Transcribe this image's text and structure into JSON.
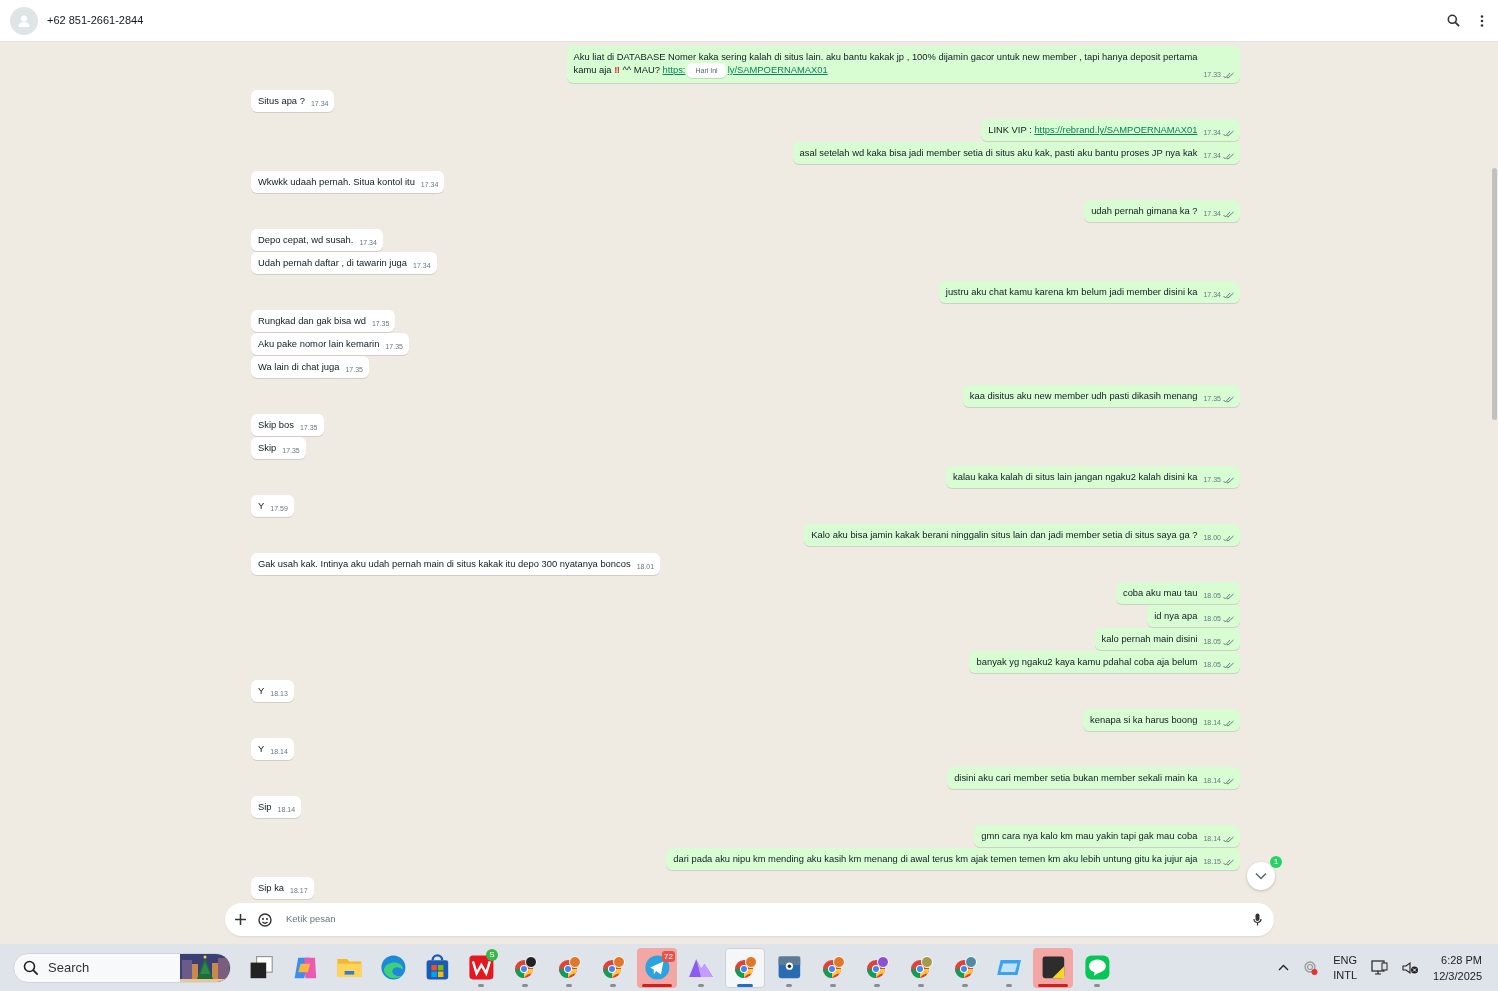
{
  "header": {
    "contact": "+62 851-2661-2844"
  },
  "date_chip": "Hari Ini",
  "messages": [
    {
      "outgoing": true,
      "time": "17.33",
      "segments": [
        {
          "kind": "text",
          "text": "Aku liat di DATABASE Nomer kaka sering kalah di situs lain. aku bantu kakak jp , 100% dijamin gacor untuk new member , tapi hanya deposit pertama"
        },
        {
          "kind": "break"
        },
        {
          "kind": "text",
          "text": "kamu aja "
        },
        {
          "kind": "alert",
          "text": "‼"
        },
        {
          "kind": "text",
          "text": " ^^ MAU? "
        },
        {
          "kind": "link",
          "text": "https:"
        },
        {
          "kind": "chip"
        },
        {
          "kind": "link",
          "text": "ly/SAMPOERNAMAX01"
        }
      ]
    },
    {
      "outgoing": false,
      "time": "17.34",
      "text": "Situs apa ?"
    },
    {
      "outgoing": true,
      "time": "17.34",
      "segments": [
        {
          "kind": "text",
          "text": "LINK VIP : "
        },
        {
          "kind": "link",
          "text": "https://rebrand.ly/SAMPOERNAMAX01"
        }
      ]
    },
    {
      "outgoing": true,
      "time": "17.34",
      "text": "asal setelah wd kaka bisa jadi member setia di situs aku kak, pasti aku bantu proses JP nya kak"
    },
    {
      "outgoing": false,
      "time": "17.34",
      "text": "Wkwkk udaah pernah. Situa kontol itu"
    },
    {
      "outgoing": true,
      "time": "17.34",
      "text": "udah pernah gimana ka ?"
    },
    {
      "outgoing": false,
      "time": "17.34",
      "text": "Depo cepat, wd susah."
    },
    {
      "outgoing": false,
      "time": "17.34",
      "text": "Udah pernah daftar , di tawarin juga"
    },
    {
      "outgoing": true,
      "time": "17.34",
      "text": "justru aku chat kamu karena km belum jadi member disini ka"
    },
    {
      "outgoing": false,
      "time": "17.35",
      "text": "Rungkad dan gak bisa wd"
    },
    {
      "outgoing": false,
      "time": "17.35",
      "text": "Aku pake nomor lain kemarin"
    },
    {
      "outgoing": false,
      "time": "17.35",
      "text": "Wa lain di chat juga"
    },
    {
      "outgoing": true,
      "time": "17.35",
      "text": "kaa disitus aku new member udh pasti dikasih menang"
    },
    {
      "outgoing": false,
      "time": "17.35",
      "text": "Skip bos"
    },
    {
      "outgoing": false,
      "time": "17.35",
      "text": "Skip"
    },
    {
      "outgoing": true,
      "time": "17.35",
      "text": "kalau kaka kalah di situs lain jangan ngaku2 kalah disini ka"
    },
    {
      "outgoing": false,
      "time": "17.59",
      "text": "Y"
    },
    {
      "outgoing": true,
      "time": "18.00",
      "text": "Kalo aku  bisa jamin kakak berani ninggalin situs lain dan jadi member setia di situs saya ga ?"
    },
    {
      "outgoing": false,
      "time": "18.01",
      "text": "Gak usah kak. Intinya aku udah pernah main di situs kakak itu depo 300 nyatanya boncos"
    },
    {
      "outgoing": true,
      "time": "18.05",
      "text": "coba aku mau tau"
    },
    {
      "outgoing": true,
      "time": "18.05",
      "text": "id nya apa"
    },
    {
      "outgoing": true,
      "time": "18.05",
      "text": "kalo pernah main disini"
    },
    {
      "outgoing": true,
      "time": "18.05",
      "text": "banyak yg ngaku2 kaya kamu pdahal coba aja belum"
    },
    {
      "outgoing": false,
      "time": "18.13",
      "text": "Y"
    },
    {
      "outgoing": true,
      "time": "18.14",
      "text": "kenapa si ka harus boong"
    },
    {
      "outgoing": false,
      "time": "18.14",
      "text": "Y"
    },
    {
      "outgoing": true,
      "time": "18.14",
      "text": "disini aku cari member setia bukan member sekali main ka"
    },
    {
      "outgoing": false,
      "time": "18.14",
      "text": "Sip"
    },
    {
      "outgoing": true,
      "time": "18.14",
      "text": "gmn cara nya kalo km mau yakin tapi gak mau coba"
    },
    {
      "outgoing": true,
      "time": "18.15",
      "text": "dari pada aku nipu km mending aku kasih km menang di awal terus km ajak temen temen km aku lebih untung gitu ka jujur aja"
    },
    {
      "outgoing": false,
      "time": "18.17",
      "text": "Sip ka"
    }
  ],
  "scroll_button": {
    "badge": "1"
  },
  "composer": {
    "placeholder": "Ketik pesan"
  },
  "taskbar": {
    "search": {
      "placeholder": "Search"
    },
    "apps": [
      {
        "kind": "taskview",
        "running": false,
        "selected": false,
        "flashing": false
      },
      {
        "kind": "copilot",
        "running": false,
        "selected": false,
        "flashing": false
      },
      {
        "kind": "folder",
        "running": false,
        "selected": false,
        "flashing": false
      },
      {
        "kind": "edge",
        "running": false,
        "selected": false,
        "flashing": false
      },
      {
        "kind": "store",
        "running": false,
        "selected": false,
        "flashing": false
      },
      {
        "kind": "wps",
        "running": true,
        "selected": false,
        "flashing": false,
        "badge": "S"
      },
      {
        "kind": "chrome",
        "running": true,
        "selected": false,
        "flashing": false,
        "color": "#222222"
      },
      {
        "kind": "chrome",
        "running": true,
        "selected": false,
        "flashing": false,
        "color": "#e0782c"
      },
      {
        "kind": "chrome",
        "running": true,
        "selected": false,
        "flashing": false,
        "color": "#e0782c"
      },
      {
        "kind": "telegram",
        "running": true,
        "selected": false,
        "flashing": true,
        "badge": "72"
      },
      {
        "kind": "mountain",
        "running": true,
        "selected": false,
        "flashing": false
      },
      {
        "kind": "chrome",
        "running": true,
        "selected": true,
        "flashing": false,
        "color": "#e0782c"
      },
      {
        "kind": "box",
        "running": true,
        "selected": false,
        "flashing": false
      },
      {
        "kind": "chrome",
        "running": true,
        "selected": false,
        "flashing": false,
        "color": "#e0782c"
      },
      {
        "kind": "chrome",
        "running": true,
        "selected": false,
        "flashing": false,
        "color": "#8b4fd6"
      },
      {
        "kind": "chrome",
        "running": true,
        "selected": false,
        "flashing": false,
        "color": "#a39a4c"
      },
      {
        "kind": "chrome",
        "running": true,
        "selected": false,
        "flashing": false,
        "color": "#4f8aa3"
      },
      {
        "kind": "window",
        "running": true,
        "selected": false,
        "flashing": false
      },
      {
        "kind": "notes",
        "running": true,
        "selected": false,
        "flashing": true
      },
      {
        "kind": "line",
        "running": true,
        "selected": false,
        "flashing": false
      }
    ],
    "tray": {
      "language": "ENG",
      "layout": "INTL",
      "time": "6:28 PM",
      "date": "12/3/2025"
    }
  }
}
